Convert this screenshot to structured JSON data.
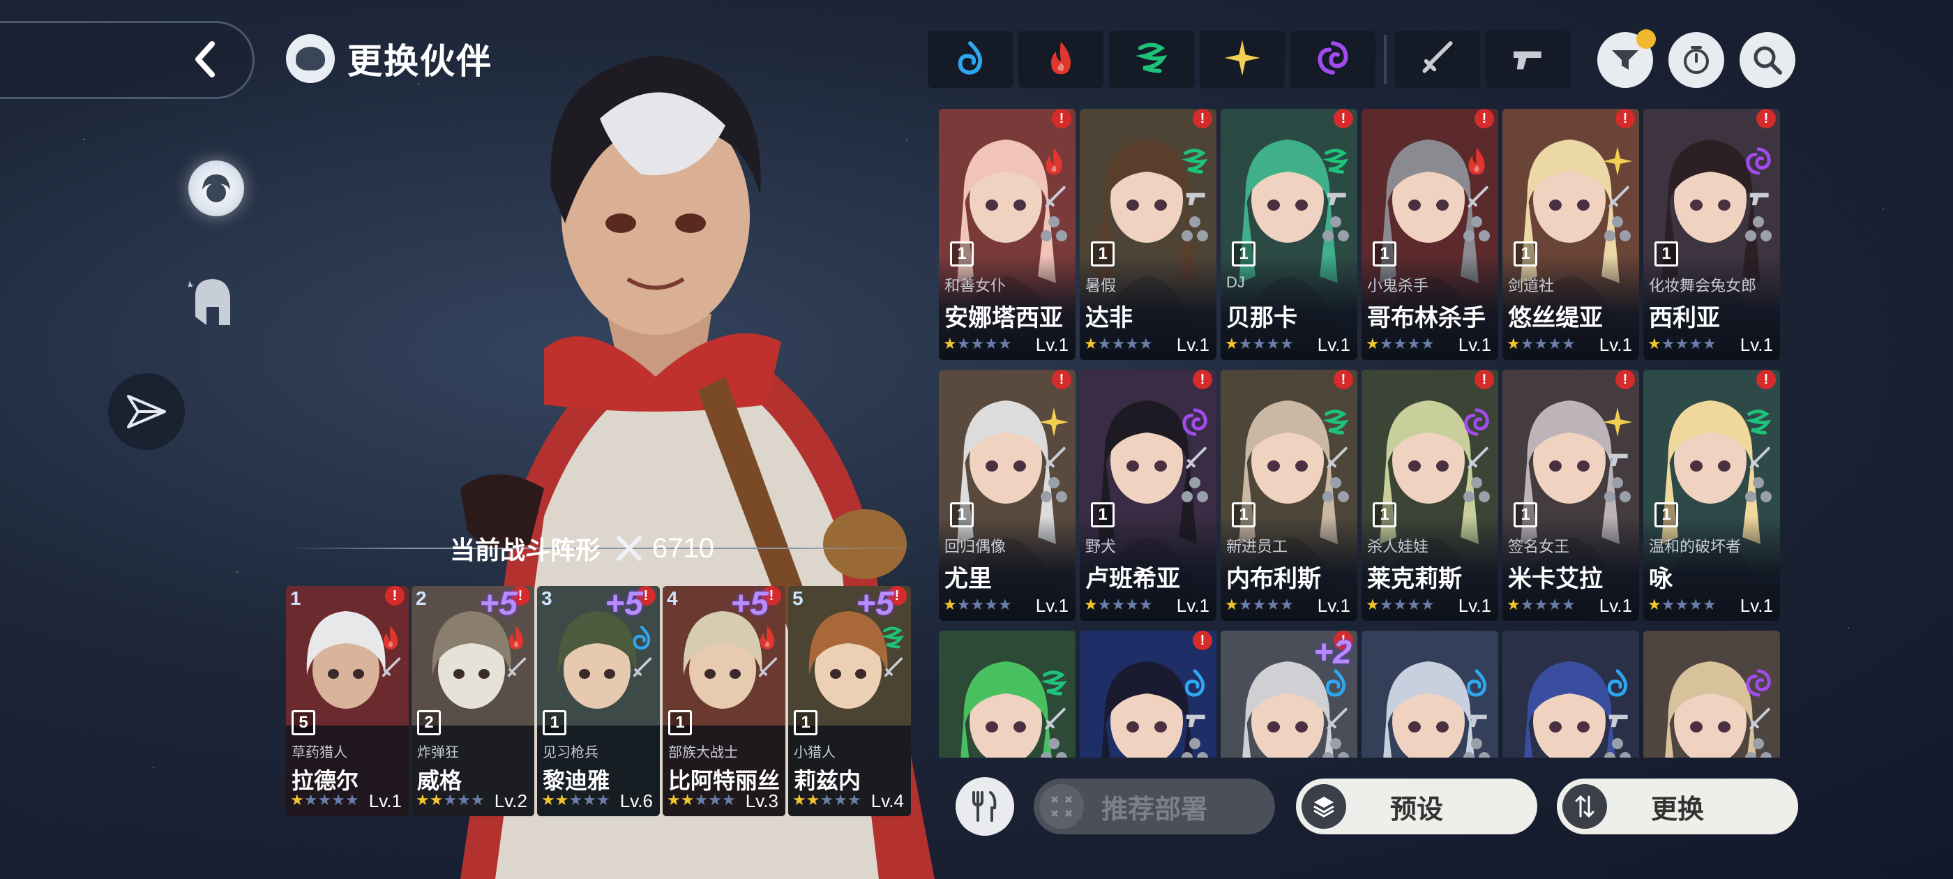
{
  "page_title": "更换伙伴",
  "formation": {
    "label": "当前战斗阵形",
    "power": "6710"
  },
  "team": [
    {
      "slot": "1",
      "plus": "",
      "element": "fire",
      "rank": "5",
      "subtitle": "草药猎人",
      "name": "拉德尔",
      "stars": 1,
      "level": "Lv.1",
      "alert": true,
      "bg": "#6b2a2e",
      "skin": "#d9b39a",
      "hair": "#e8e8ea"
    },
    {
      "slot": "2",
      "plus": "+5",
      "element": "fire",
      "rank": "2",
      "subtitle": "炸弹狂",
      "name": "威格",
      "stars": 2,
      "level": "Lv.2",
      "alert": true,
      "bg": "#5a4e48",
      "skin": "#e6e2d8",
      "hair": "#8a7e6e"
    },
    {
      "slot": "3",
      "plus": "+5",
      "element": "water",
      "rank": "1",
      "subtitle": "见习枪兵",
      "name": "黎迪雅",
      "stars": 2,
      "level": "Lv.6",
      "alert": true,
      "bg": "#3e4a48",
      "skin": "#e6c9ae",
      "hair": "#4c5a3e"
    },
    {
      "slot": "4",
      "plus": "+5",
      "element": "fire",
      "rank": "1",
      "subtitle": "部族大战士",
      "name": "比阿特丽丝",
      "stars": 2,
      "level": "Lv.3",
      "alert": true,
      "bg": "#6a3a30",
      "skin": "#e6cbb0",
      "hair": "#d8ccb0"
    },
    {
      "slot": "5",
      "plus": "+5",
      "element": "wind",
      "rank": "1",
      "subtitle": "小猎人",
      "name": "莉兹内",
      "stars": 2,
      "level": "Lv.4",
      "alert": true,
      "bg": "#4c4432",
      "skin": "#ecd0b4",
      "hair": "#a8683a"
    }
  ],
  "filters": [
    "water",
    "fire",
    "wind",
    "light",
    "dark",
    "sword",
    "gun"
  ],
  "roster": [
    {
      "name": "安娜塔西亚",
      "subtitle": "和善女仆",
      "element": "fire",
      "weapon": "sword",
      "rank": "1",
      "level": "Lv.1",
      "stars": 1,
      "alert": true,
      "bg": "#7a3a3a",
      "hair": "#f1c4b8"
    },
    {
      "name": "达非",
      "subtitle": "暑假",
      "element": "wind",
      "weapon": "gun",
      "rank": "1",
      "level": "Lv.1",
      "stars": 1,
      "alert": true,
      "bg": "#4e4436",
      "hair": "#5a3e2c"
    },
    {
      "name": "贝那卡",
      "subtitle": "DJ",
      "element": "wind",
      "weapon": "gun",
      "rank": "1",
      "level": "Lv.1",
      "stars": 1,
      "alert": true,
      "bg": "#2c4a44",
      "hair": "#3fb08a"
    },
    {
      "name": "哥布林杀手",
      "subtitle": "小鬼杀手",
      "element": "fire",
      "weapon": "sword",
      "rank": "1",
      "level": "Lv.1",
      "stars": 1,
      "alert": true,
      "bg": "#5c2a2c",
      "hair": "#8a8a90"
    },
    {
      "name": "悠丝缇亚",
      "subtitle": "剑道社",
      "element": "light",
      "weapon": "sword",
      "rank": "1",
      "level": "Lv.1",
      "stars": 1,
      "alert": true,
      "bg": "#6a4436",
      "hair": "#ecd8a6"
    },
    {
      "name": "西利亚",
      "subtitle": "化妆舞会兔女郎",
      "element": "dark",
      "weapon": "gun",
      "rank": "1",
      "level": "Lv.1",
      "stars": 1,
      "alert": true,
      "bg": "#3e3440",
      "hair": "#2c2024"
    },
    {
      "name": "尤里",
      "subtitle": "回归偶像",
      "element": "light",
      "weapon": "sword",
      "rank": "1",
      "level": "Lv.1",
      "stars": 1,
      "alert": true,
      "bg": "#5a4a3e",
      "hair": "#dcdcdc"
    },
    {
      "name": "卢班希亚",
      "subtitle": "野犬",
      "element": "dark",
      "weapon": "sword",
      "rank": "1",
      "level": "Lv.1",
      "stars": 1,
      "alert": true,
      "bg": "#3a2c44",
      "hair": "#1e1a24"
    },
    {
      "name": "内布利斯",
      "subtitle": "新进员工",
      "element": "wind",
      "weapon": "sword",
      "rank": "1",
      "level": "Lv.1",
      "stars": 1,
      "alert": true,
      "bg": "#4e4638",
      "hair": "#c9b8a4"
    },
    {
      "name": "莱克莉斯",
      "subtitle": "杀人娃娃",
      "element": "dark",
      "weapon": "sword",
      "rank": "1",
      "level": "Lv.1",
      "stars": 1,
      "alert": true,
      "bg": "#3c4436",
      "hair": "#c8cf9a"
    },
    {
      "name": "米卡艾拉",
      "subtitle": "签名女王",
      "element": "light",
      "weapon": "gun",
      "rank": "1",
      "level": "Lv.1",
      "stars": 1,
      "alert": true,
      "bg": "#443c3e",
      "hair": "#bdb4b8"
    },
    {
      "name": "咏",
      "subtitle": "温和的破坏者",
      "element": "wind",
      "weapon": "sword",
      "rank": "1",
      "level": "Lv.1",
      "stars": 1,
      "alert": true,
      "bg": "#2e4a48",
      "hair": "#f0d89c"
    },
    {
      "name": "",
      "subtitle": "",
      "element": "wind",
      "weapon": "sword",
      "rank": "",
      "level": "",
      "stars": 0,
      "alert": false,
      "bg": "#2c4a36",
      "hair": "#48c060"
    },
    {
      "name": "",
      "subtitle": "",
      "element": "water",
      "weapon": "gun",
      "rank": "",
      "level": "",
      "stars": 0,
      "alert": true,
      "bg": "#1e2e66",
      "hair": "#1a1a30"
    },
    {
      "name": "",
      "subtitle": "",
      "element": "water",
      "weapon": "sword",
      "rank": "",
      "level": "",
      "stars": 0,
      "alert": true,
      "plus": "+2",
      "bg": "#4a4e58",
      "hair": "#cfcfd4"
    },
    {
      "name": "",
      "subtitle": "",
      "element": "water",
      "weapon": "gun",
      "rank": "",
      "level": "",
      "stars": 0,
      "alert": false,
      "bg": "#34405a",
      "hair": "#c8d0e0"
    },
    {
      "name": "",
      "subtitle": "",
      "element": "water",
      "weapon": "gun",
      "rank": "",
      "level": "",
      "stars": 0,
      "alert": false,
      "bg": "#2a3048",
      "hair": "#3a4ea0"
    },
    {
      "name": "",
      "subtitle": "",
      "element": "dark",
      "weapon": "sword",
      "rank": "",
      "level": "",
      "stars": 0,
      "alert": false,
      "bg": "#4e4440",
      "hair": "#d8c29c"
    }
  ],
  "actions": {
    "recommend": "推荐部署",
    "preset": "预设",
    "swap": "更换"
  },
  "colors": {
    "water": "#2fa6f0",
    "fire": "#e0362e",
    "wind": "#1ec37a",
    "light": "#f2cf52",
    "dark": "#a24cf0",
    "star": "#f2c530",
    "alert": "#d62b2b"
  }
}
